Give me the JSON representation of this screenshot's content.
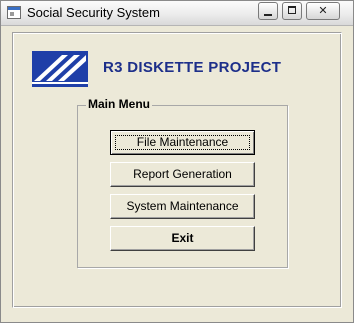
{
  "window": {
    "title": "Social Security System",
    "controls": {
      "minimize_icon": "minimize-icon",
      "maximize_icon": "maximize-icon",
      "close_glyph": "✕"
    }
  },
  "header": {
    "logo_icon": "sss-logo-icon",
    "title": "R3 DISKETTE PROJECT"
  },
  "main_menu": {
    "label": "Main Menu",
    "buttons": [
      {
        "label": "File Maintenance"
      },
      {
        "label": "Report Generation"
      },
      {
        "label": "System Maintenance"
      },
      {
        "label": "Exit"
      }
    ]
  },
  "colors": {
    "window_bg": "#ece9d8",
    "title_text": "#1d2f8a",
    "logo_blue": "#1f3fa8"
  }
}
